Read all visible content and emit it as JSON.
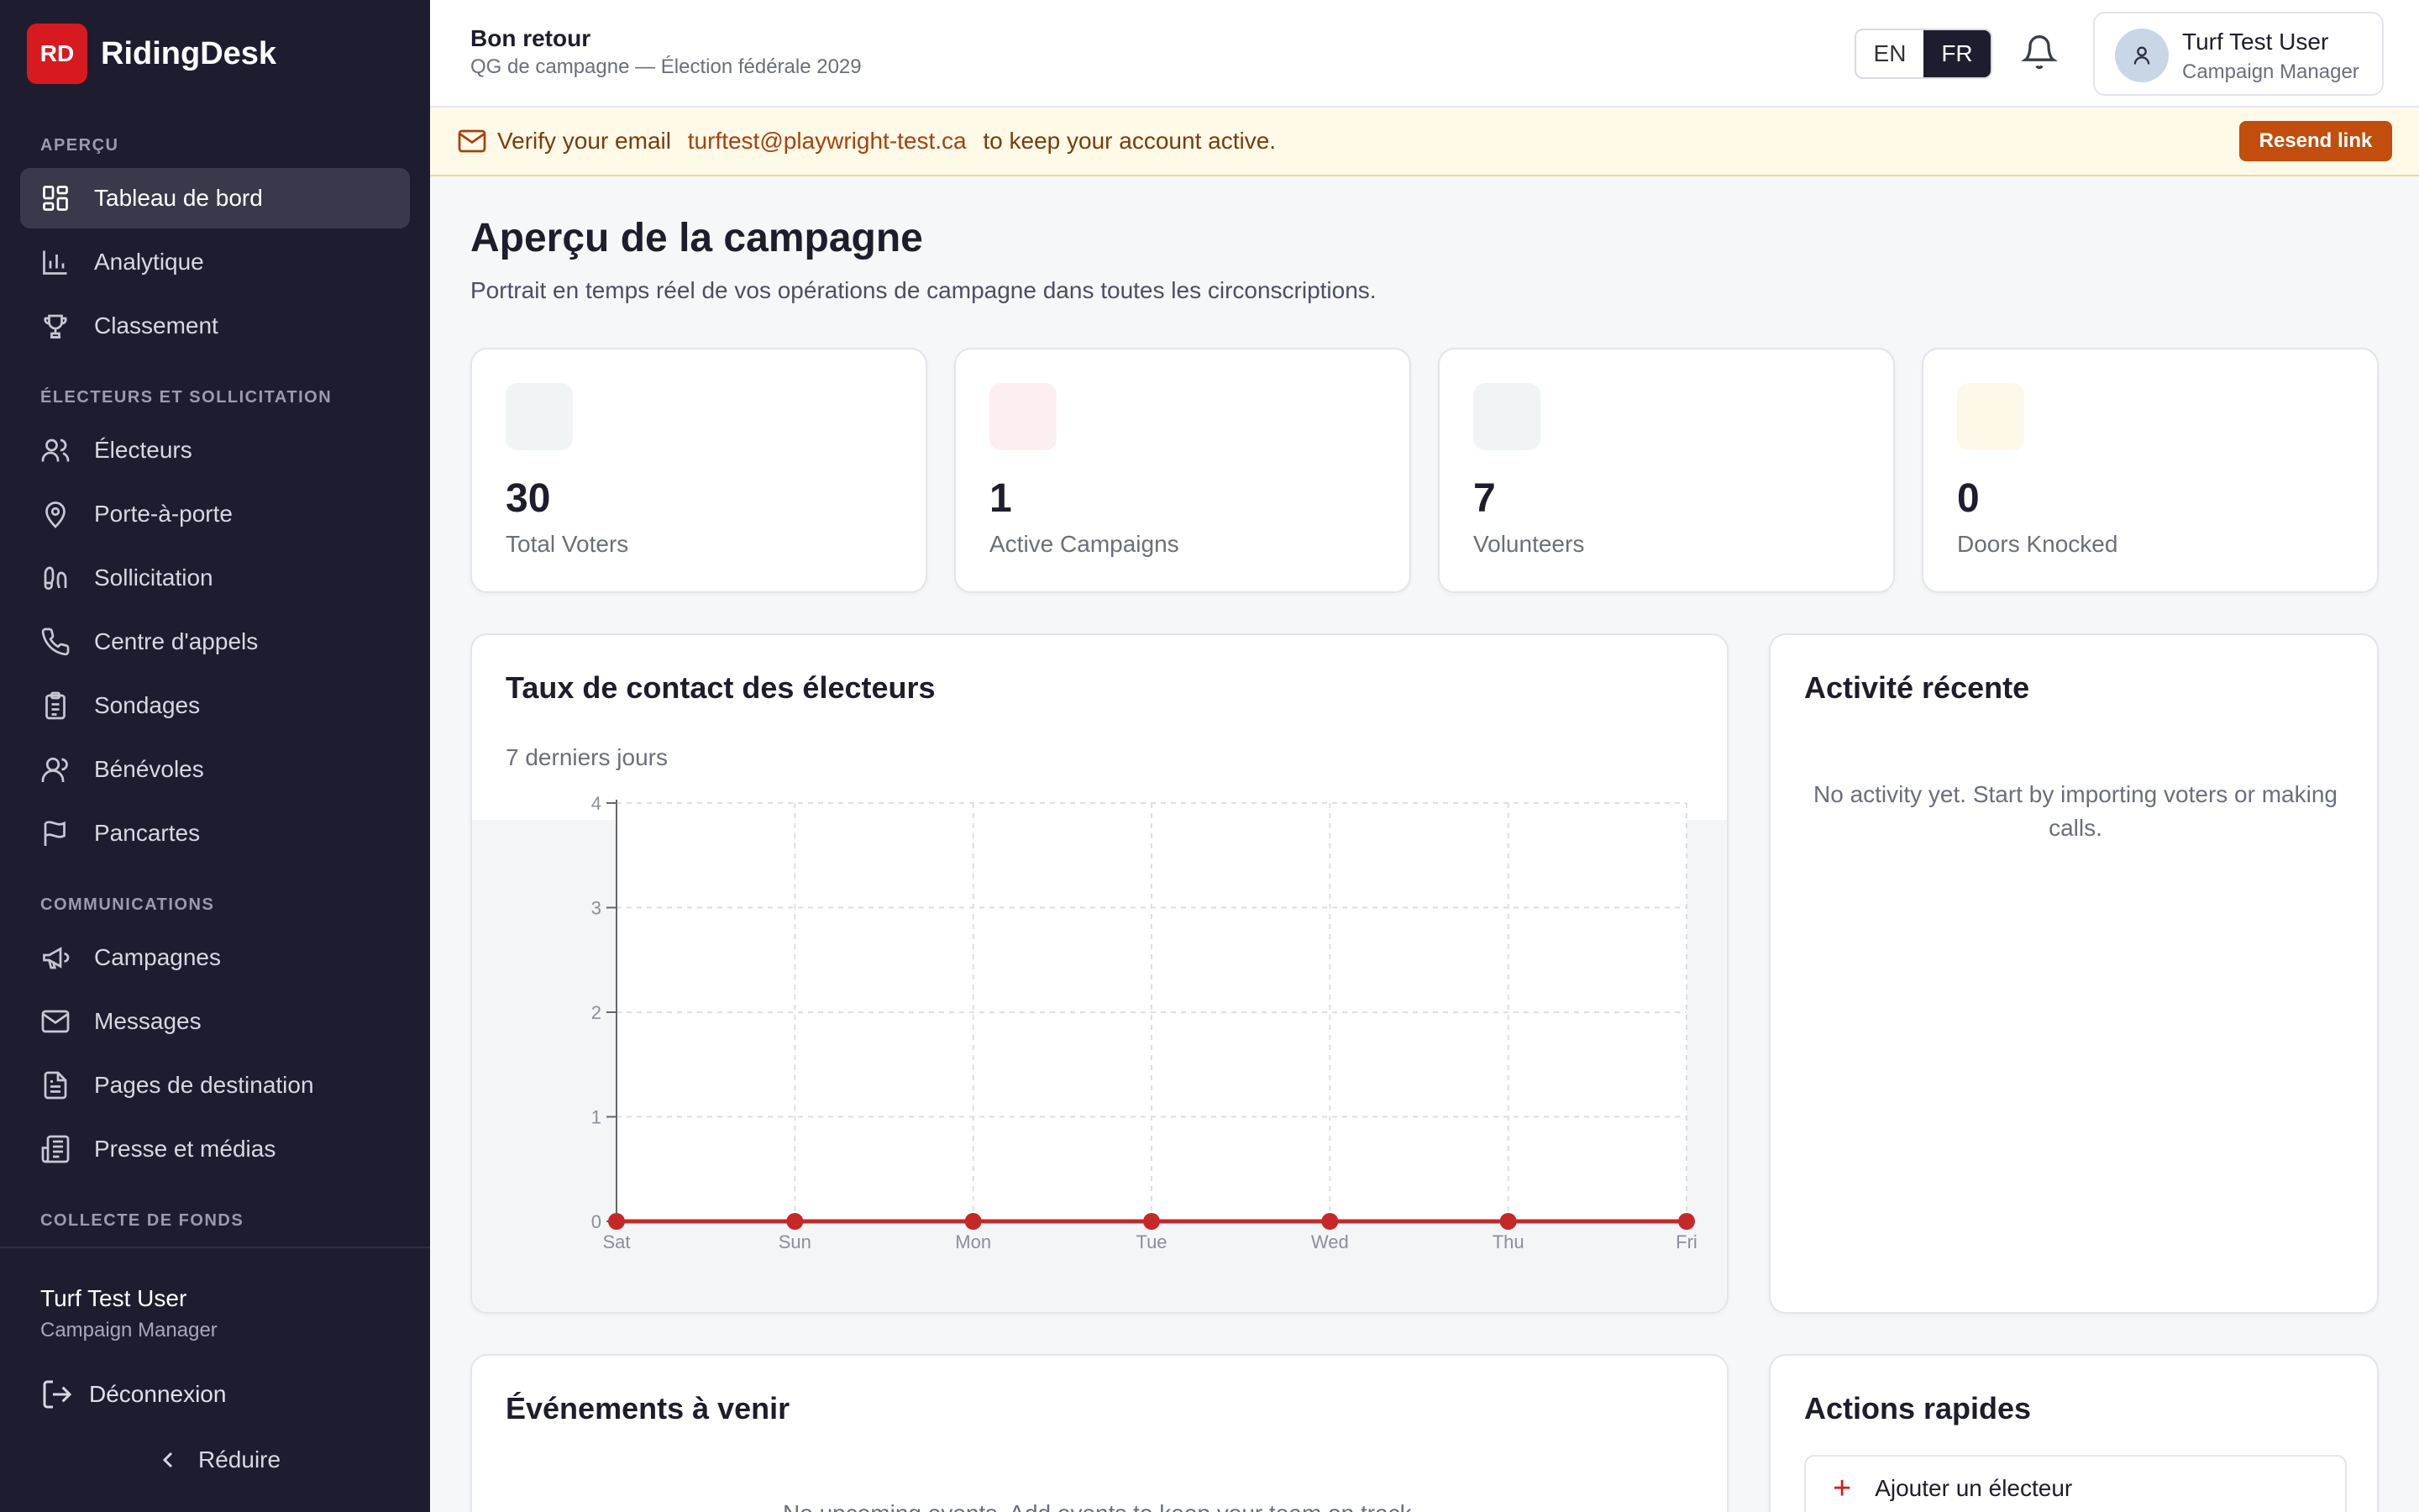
{
  "brand": {
    "logo_text": "RD",
    "name": "RidingDesk",
    "color": "#d71a20"
  },
  "sidebar": {
    "sections": [
      {
        "label": "APERÇU"
      },
      {
        "label": "ÉLECTEURS ET SOLLICITATION"
      },
      {
        "label": "COMMUNICATIONS"
      },
      {
        "label": "COLLECTE DE FONDS"
      }
    ],
    "items": [
      {
        "label": "Tableau de bord",
        "icon": "dashboard-icon"
      },
      {
        "label": "Analytique",
        "icon": "bar-chart-icon"
      },
      {
        "label": "Classement",
        "icon": "trophy-icon"
      },
      {
        "label": "Électeurs",
        "icon": "users-icon"
      },
      {
        "label": "Porte-à-porte",
        "icon": "map-pin-icon"
      },
      {
        "label": "Sollicitation",
        "icon": "footprints-icon"
      },
      {
        "label": "Centre d'appels",
        "icon": "phone-icon"
      },
      {
        "label": "Sondages",
        "icon": "clipboard-list-icon"
      },
      {
        "label": "Bénévoles",
        "icon": "user-icon"
      },
      {
        "label": "Pancartes",
        "icon": "flag-icon"
      },
      {
        "label": "Campagnes",
        "icon": "megaphone-icon"
      },
      {
        "label": "Messages",
        "icon": "mail-icon"
      },
      {
        "label": "Pages de destination",
        "icon": "file-text-icon"
      },
      {
        "label": "Presse et médias",
        "icon": "newspaper-icon"
      }
    ],
    "user": {
      "name": "Turf Test User",
      "role": "Campaign Manager"
    },
    "logout_label": "Déconnexion",
    "collapse_label": "Réduire"
  },
  "header": {
    "welcome": "Bon retour",
    "subtitle": "QG de campagne — Élection fédérale 2029",
    "lang_en": "EN",
    "lang_fr": "FR",
    "user_name": "Turf Test User",
    "user_role": "Campaign Manager"
  },
  "banner": {
    "prefix": "Verify your email",
    "email": "turftest@playwright-test.ca",
    "suffix": "to keep your account active.",
    "button": "Resend link"
  },
  "main": {
    "title": "Aperçu de la campagne",
    "subtitle": "Portrait en temps réel de vos opérations de campagne dans toutes les circonscriptions.",
    "stats": [
      {
        "value": "30",
        "label": "Total Voters",
        "icon_color": "#f1f4f4"
      },
      {
        "value": "1",
        "label": "Active Campaigns",
        "icon_color": "#fdeff0"
      },
      {
        "value": "7",
        "label": "Volunteers",
        "icon_color": "#f1f4f4"
      },
      {
        "value": "0",
        "label": "Doors Knocked",
        "icon_color": "#fdf8e7"
      }
    ],
    "contact_chart": {
      "title": "Taux de contact des électeurs",
      "subtitle": "7 derniers jours"
    },
    "activity": {
      "title": "Activité récente",
      "empty": "No activity yet. Start by importing voters or making calls."
    },
    "events": {
      "title": "Événements à venir",
      "empty": "No upcoming events. Add events to keep your team on track."
    },
    "quick_actions": {
      "title": "Actions rapides",
      "add_voter": "Ajouter un électeur"
    }
  },
  "chart_data": {
    "type": "line",
    "categories": [
      "Sat",
      "Sun",
      "Mon",
      "Tue",
      "Wed",
      "Thu",
      "Fri"
    ],
    "series": [
      {
        "values": [
          0,
          0,
          0,
          0,
          0,
          0,
          0
        ],
        "color": "#c62828"
      }
    ],
    "ylim": [
      0,
      4
    ],
    "yticks": [
      0,
      1,
      2,
      3,
      4
    ],
    "grid": true
  }
}
